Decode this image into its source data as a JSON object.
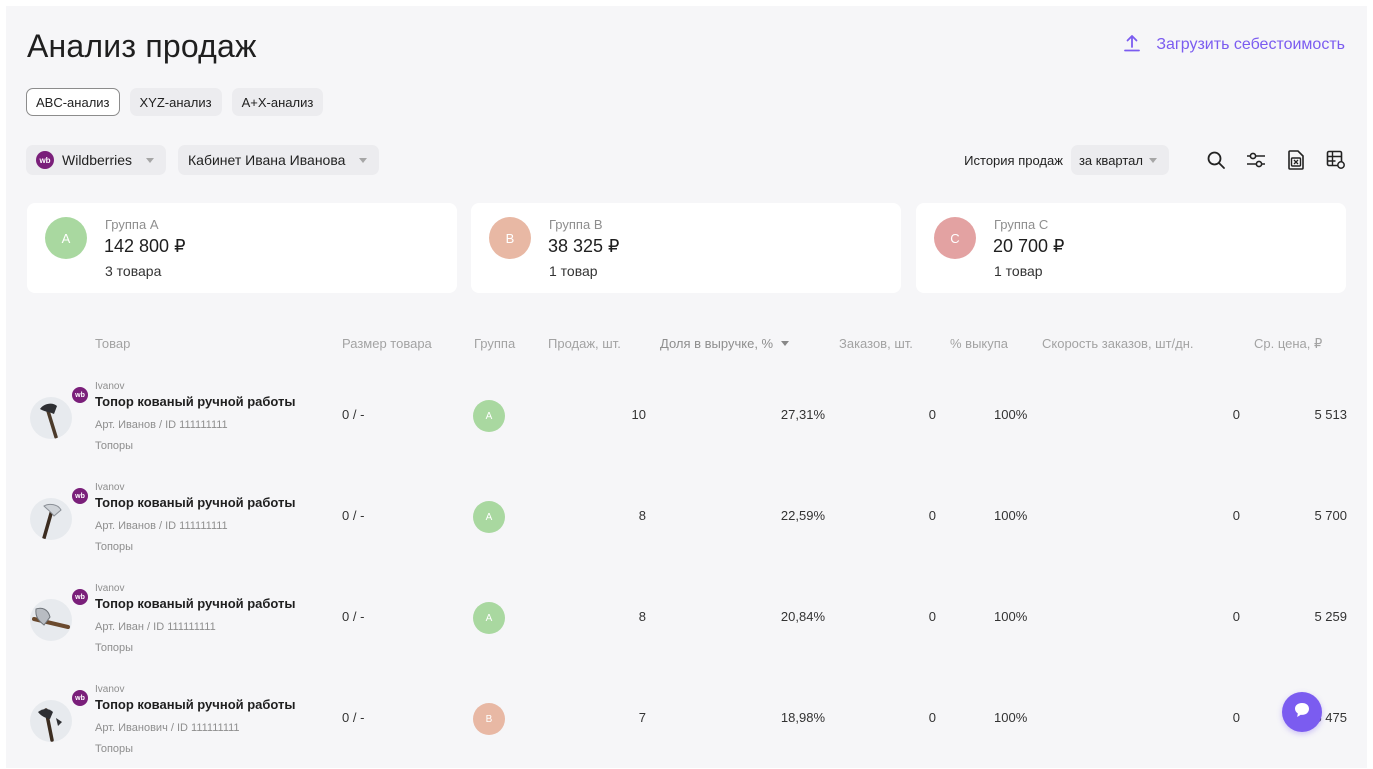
{
  "header": {
    "title": "Анализ продаж",
    "upload_label": "Загрузить себестоимость"
  },
  "tabs": [
    {
      "label": "ABC-анализ",
      "active": true
    },
    {
      "label": "XYZ-анализ",
      "active": false
    },
    {
      "label": "A+X-анализ",
      "active": false
    }
  ],
  "filters": {
    "marketplace": "Wildberries",
    "marketplace_badge": "wb",
    "cabinet": "Кабинет Ивана Иванова",
    "history_label": "История продаж",
    "period": "за квартал"
  },
  "toolbar_icons": [
    "search-icon",
    "filter-sliders-icon",
    "export-excel-icon",
    "table-settings-icon"
  ],
  "groups": [
    {
      "letter": "A",
      "name": "Группа A",
      "sum": "142 800 ₽",
      "count": "3 товара",
      "color": "#a9d8a0"
    },
    {
      "letter": "B",
      "name": "Группа B",
      "sum": "38 325 ₽",
      "count": "1 товар",
      "color": "#e8b8a4"
    },
    {
      "letter": "C",
      "name": "Группа C",
      "sum": "20 700 ₽",
      "count": "1 товар",
      "color": "#e3a2a2"
    }
  ],
  "table": {
    "columns": {
      "product": "Товар",
      "size": "Размер товара",
      "group": "Группа",
      "sales": "Продаж, шт.",
      "share": "Доля в выручке, %",
      "orders": "Заказов, шт.",
      "buyout": "% выкупа",
      "speed": "Скорость заказов, шт/дн.",
      "price": "Ср. цена, ₽"
    },
    "rows": [
      {
        "seller": "Ivanov",
        "name": "Топор кованый ручной работы",
        "article": "Арт. Иванов / ID 111111111",
        "category": "Топоры",
        "size": "0 / -",
        "group": "A",
        "sales": "10",
        "share": "27,31%",
        "orders": "0",
        "buyout": "100%",
        "speed": "0",
        "price": "5 513"
      },
      {
        "seller": "Ivanov",
        "name": "Топор кованый ручной работы",
        "article": "Арт. Иванов / ID 111111111",
        "category": "Топоры",
        "size": "0 / -",
        "group": "A",
        "sales": "8",
        "share": "22,59%",
        "orders": "0",
        "buyout": "100%",
        "speed": "0",
        "price": "5 700"
      },
      {
        "seller": "Ivanov",
        "name": "Топор кованый ручной работы",
        "article": "Арт. Иван / ID 111111111",
        "category": "Топоры",
        "size": "0 / -",
        "group": "A",
        "sales": "8",
        "share": "20,84%",
        "orders": "0",
        "buyout": "100%",
        "speed": "0",
        "price": "5 259"
      },
      {
        "seller": "Ivanov",
        "name": "Топор кованый ручной работы",
        "article": "Арт. Иванович / ID 111111111",
        "category": "Топоры",
        "size": "0 / -",
        "group": "B",
        "sales": "7",
        "share": "18,98%",
        "orders": "0",
        "buyout": "100%",
        "speed": "0",
        "price": "5 475"
      }
    ]
  },
  "colors": {
    "accent": "#7b5cf0",
    "wb_badge": "#7a1f7a",
    "group_a": "#a9d8a0",
    "group_b": "#e8b8a4",
    "group_c": "#e3a2a2"
  }
}
